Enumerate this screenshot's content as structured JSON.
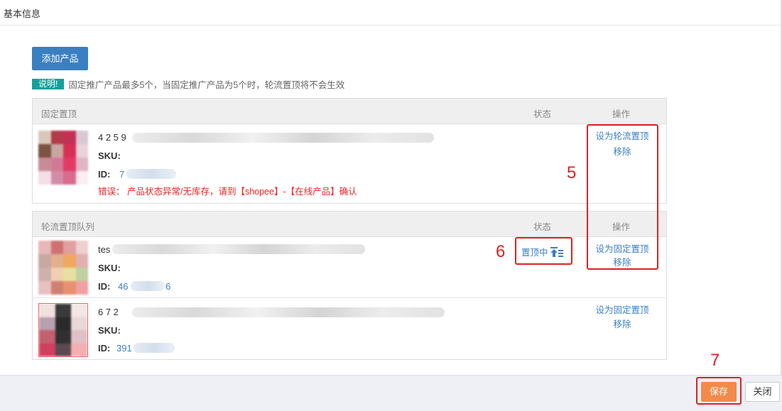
{
  "header": {
    "title": "基本信息"
  },
  "toolbar": {
    "add_product_label": "添加产品"
  },
  "notice": {
    "badge": "说明!",
    "text": "固定推广产品最多5个，当固定推广产品为5个时，轮流置顶将不会生效"
  },
  "fixed_panel": {
    "title": "固定置顶",
    "status_header": "状态",
    "ops_header": "操作",
    "rows": [
      {
        "name": "4 2 5 9",
        "sku_label": "SKU:",
        "id_label": "ID:",
        "id_value": "7",
        "error": "错误： 产品状态异常/无库存，请到【shopee】-【在线产品】确认",
        "op_primary": "设为轮流置顶",
        "op_remove": "移除"
      }
    ]
  },
  "rotation_panel": {
    "title": "轮流置顶队列",
    "status_header": "状态",
    "ops_header": "操作",
    "rows": [
      {
        "name": "tes",
        "sku_label": "SKU:",
        "id_label": "ID:",
        "id_value_start": "46",
        "id_value_end": "6",
        "status": "置顶中",
        "op_primary": "设为固定置顶",
        "op_remove": "移除"
      },
      {
        "name": "6 7 2",
        "sku_label": "SKU:",
        "id_label": "ID:",
        "id_value": "391",
        "op_primary": "设为固定置顶",
        "op_remove": "移除"
      }
    ]
  },
  "annotations": {
    "a5": "5",
    "a6": "6",
    "a7": "7"
  },
  "footer": {
    "save_label": "保存",
    "close_label": "关闭"
  },
  "colors": {
    "accent": "#3a7fc1",
    "save": "#f28a4a",
    "badge": "#15a19a",
    "error": "#e22222",
    "annotation": "#e02020"
  },
  "icons": {
    "status": "pin-top-icon"
  }
}
